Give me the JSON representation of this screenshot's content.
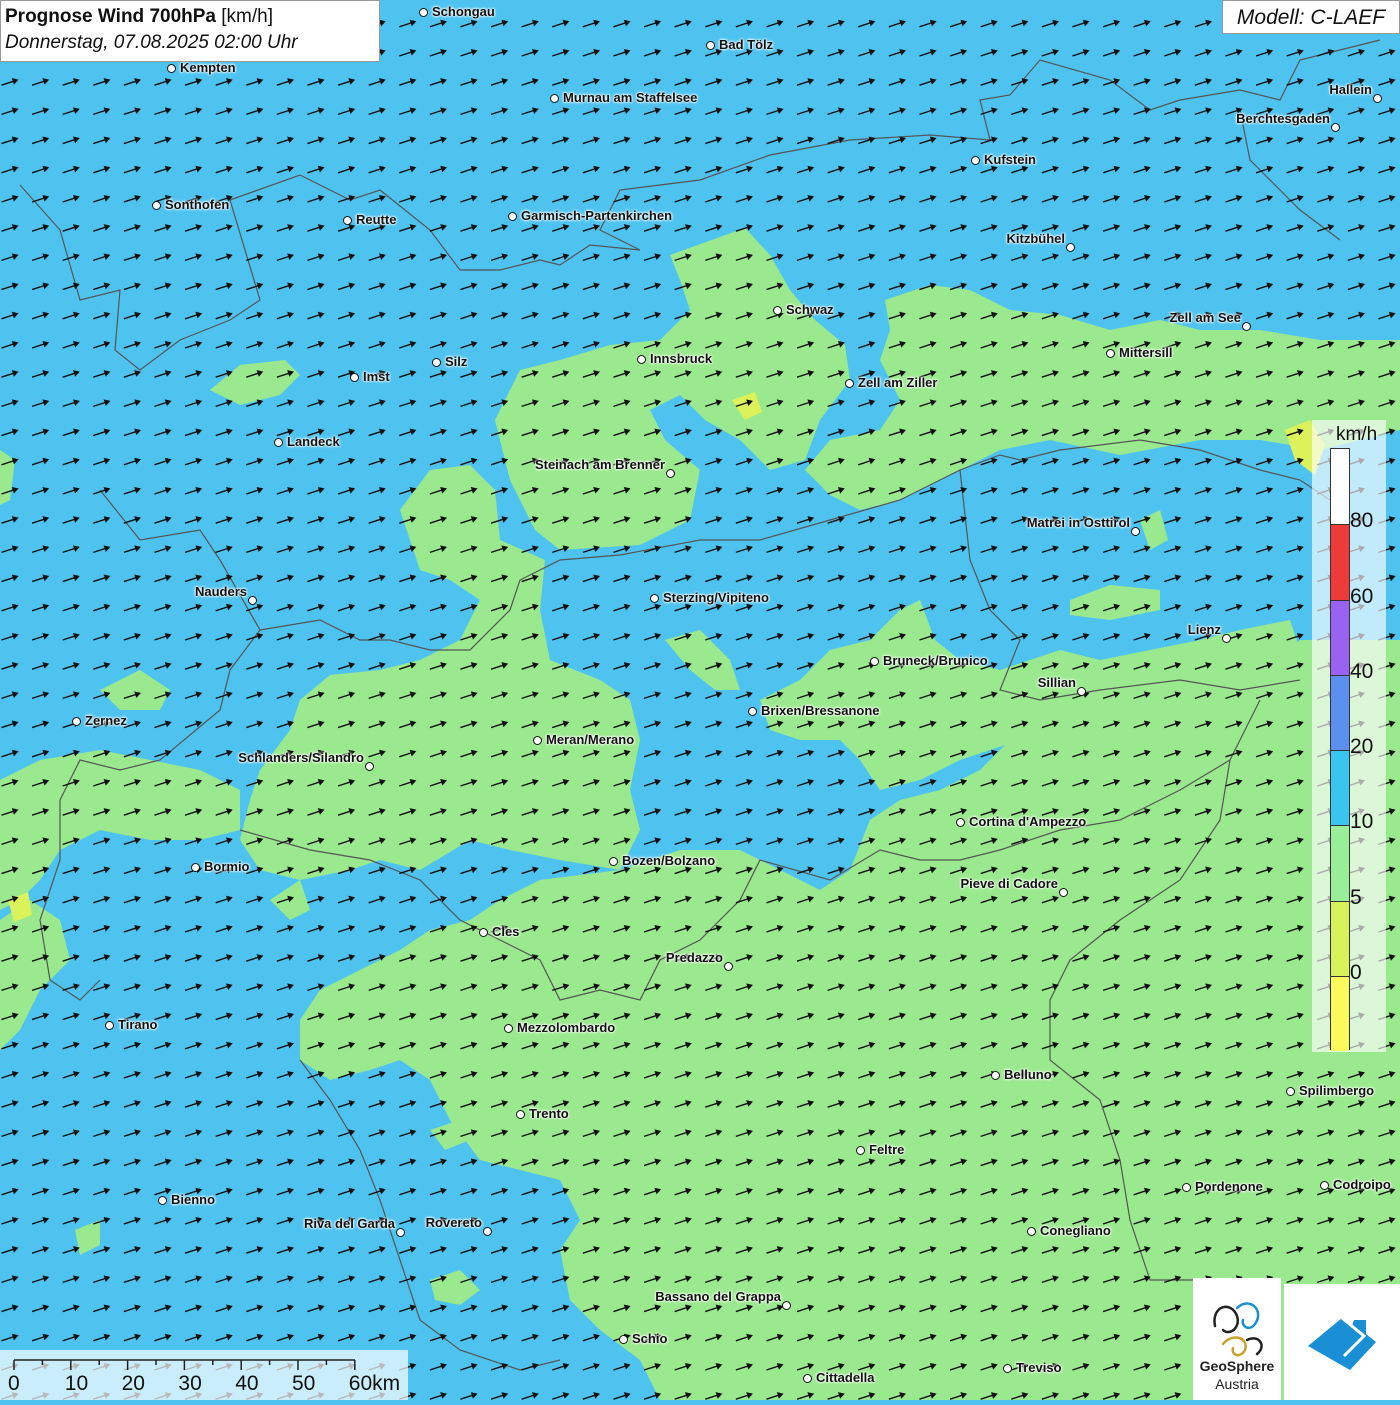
{
  "header": {
    "title_bold": "Prognose Wind 700hPa",
    "title_unit": " [km/h]",
    "datetime": "Donnerstag, 07.08.2025 02:00 Uhr",
    "model": "Modell: C-LAEF"
  },
  "colors": {
    "wind_10_20": "#9be98e",
    "wind_20_40": "#4fc3f0",
    "wind_5_10": "#dbf25a",
    "border": "#555555",
    "arrow": "#111111"
  },
  "legend": {
    "unit": "km/h",
    "labels": [
      "80",
      "60",
      "40",
      "20",
      "10",
      "5",
      "0"
    ],
    "segments": [
      {
        "color": "#ffffff"
      },
      {
        "color": "#ee3a3a"
      },
      {
        "color": "#9a62f0"
      },
      {
        "color": "#5b8ff0"
      },
      {
        "color": "#38c5f0"
      },
      {
        "color": "#98ef98"
      },
      {
        "color": "#d8f25a"
      },
      {
        "color": "#fafa5a"
      }
    ]
  },
  "scale_bar": {
    "labels": [
      "0",
      "10",
      "20",
      "30",
      "40",
      "50",
      "60km"
    ]
  },
  "logos": {
    "geosphere_line1": "GeoSphere",
    "geosphere_line2": "Austria"
  },
  "cities": [
    {
      "name": "Schongau"
    },
    {
      "name": "Bad Tölz"
    },
    {
      "name": "Kempten"
    },
    {
      "name": "Murnau am Staffelsee"
    },
    {
      "name": "Hallein"
    },
    {
      "name": "Berchtesgaden"
    },
    {
      "name": "Kufstein"
    },
    {
      "name": "Sonthofen"
    },
    {
      "name": "Reutte"
    },
    {
      "name": "Garmisch-Partenkirchen"
    },
    {
      "name": "Kitzbühel"
    },
    {
      "name": "Schwaz"
    },
    {
      "name": "Zell am See"
    },
    {
      "name": "Mittersill"
    },
    {
      "name": "Innsbruck"
    },
    {
      "name": "Silz"
    },
    {
      "name": "Imst"
    },
    {
      "name": "Zell am Ziller"
    },
    {
      "name": "Landeck"
    },
    {
      "name": "Steinach am Brenner"
    },
    {
      "name": "Matrei in Osttirol"
    },
    {
      "name": "Nauders"
    },
    {
      "name": "Sterzing/Vipiteno"
    },
    {
      "name": "Lienz"
    },
    {
      "name": "Bruneck/Brunico"
    },
    {
      "name": "Sillian"
    },
    {
      "name": "Brixen/Bressanone"
    },
    {
      "name": "Zernez"
    },
    {
      "name": "Meran/Merano"
    },
    {
      "name": "Schlanders/Silandro"
    },
    {
      "name": "Cortina d'Ampezzo"
    },
    {
      "name": "Bozen/Bolzano"
    },
    {
      "name": "Bormio"
    },
    {
      "name": "Pieve di Cadore"
    },
    {
      "name": "Cles"
    },
    {
      "name": "Predazzo"
    },
    {
      "name": "Tirano"
    },
    {
      "name": "Mezzolombardo"
    },
    {
      "name": "Belluno"
    },
    {
      "name": "Spilimbergo"
    },
    {
      "name": "Trento"
    },
    {
      "name": "Feltre"
    },
    {
      "name": "Pordenone"
    },
    {
      "name": "Codroipo"
    },
    {
      "name": "Bienno"
    },
    {
      "name": "Riva del Garda"
    },
    {
      "name": "Rovereto"
    },
    {
      "name": "Conegliano"
    },
    {
      "name": "Bassano del Grappa"
    },
    {
      "name": "Schio"
    },
    {
      "name": "Treviso"
    },
    {
      "name": "Cittadella"
    }
  ]
}
